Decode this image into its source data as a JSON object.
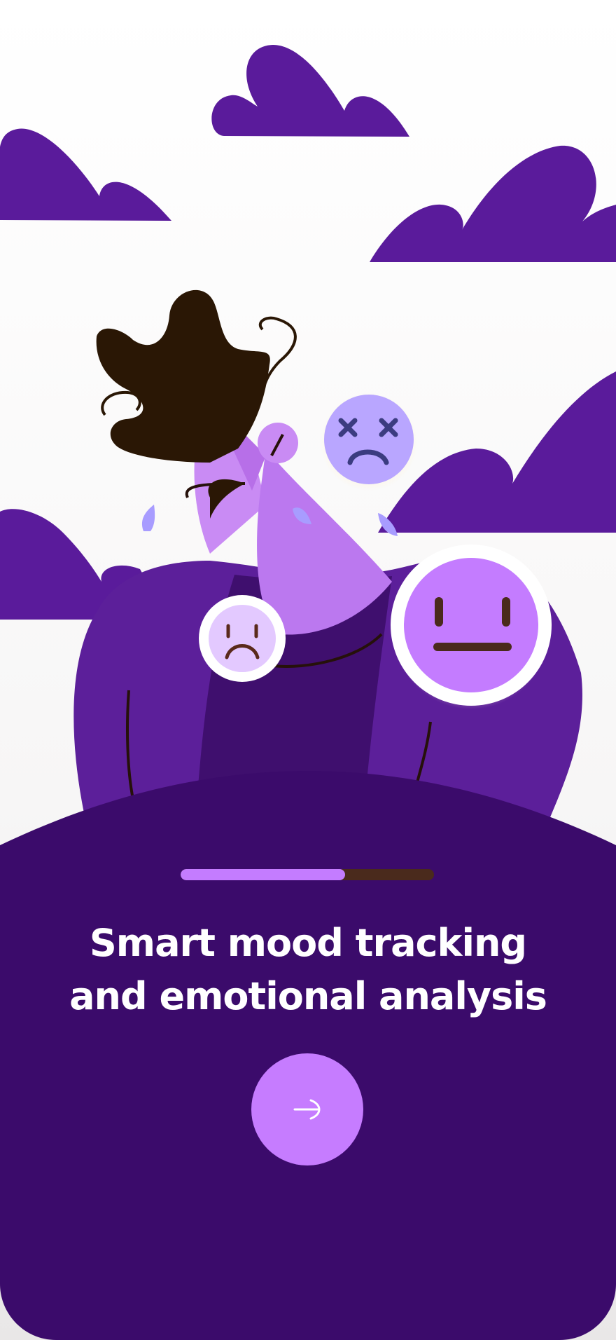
{
  "onboarding": {
    "progress": 0.65,
    "title_line1": "Smart mood tracking",
    "title_line2": "and emotional analysis",
    "next_icon": "arrow-right-icon"
  },
  "colors": {
    "cloud": "#5a1b9b",
    "panel": "#3b0b6b",
    "accent": "#c67cff",
    "progress_track": "#4a2a1c",
    "hair": "#2a1705"
  }
}
